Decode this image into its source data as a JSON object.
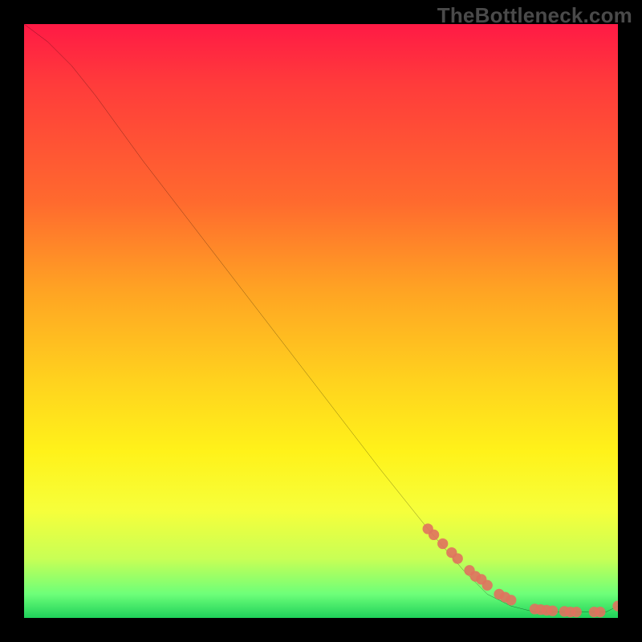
{
  "watermark": "TheBottleneck.com",
  "chart_data": {
    "type": "line",
    "title": "",
    "xlabel": "",
    "ylabel": "",
    "xlim": [
      0,
      100
    ],
    "ylim": [
      0,
      100
    ],
    "legend": false,
    "grid": false,
    "background_gradient": {
      "direction": "vertical",
      "stops": [
        {
          "pos": 0,
          "color": "#ff1a45"
        },
        {
          "pos": 0.3,
          "color": "#ff6a2e"
        },
        {
          "pos": 0.6,
          "color": "#ffd21e"
        },
        {
          "pos": 0.82,
          "color": "#f6ff3b"
        },
        {
          "pos": 0.96,
          "color": "#6dff79"
        },
        {
          "pos": 1.0,
          "color": "#1fd15a"
        }
      ]
    },
    "series": [
      {
        "name": "bottleneck-curve",
        "kind": "line",
        "color": "#000000",
        "x": [
          0,
          4,
          8,
          12,
          20,
          30,
          40,
          50,
          60,
          68,
          74,
          78,
          82,
          86,
          90,
          94,
          98,
          100
        ],
        "y": [
          100,
          97,
          93,
          88,
          77,
          64,
          51,
          38,
          25,
          15,
          8,
          4,
          2,
          1,
          1,
          1,
          1,
          2
        ]
      },
      {
        "name": "highlighted-points",
        "kind": "scatter",
        "color": "#e0725e",
        "x": [
          68,
          69,
          70.5,
          72,
          73,
          75,
          76,
          77,
          78,
          80,
          81,
          82,
          86,
          87,
          88,
          89,
          91,
          92,
          93,
          96,
          97,
          100
        ],
        "y": [
          15,
          14,
          12.5,
          11,
          10,
          8,
          7,
          6.5,
          5.5,
          4,
          3.5,
          3,
          1.5,
          1.4,
          1.3,
          1.2,
          1.1,
          1.0,
          1.0,
          1.0,
          1.0,
          2
        ]
      }
    ]
  }
}
